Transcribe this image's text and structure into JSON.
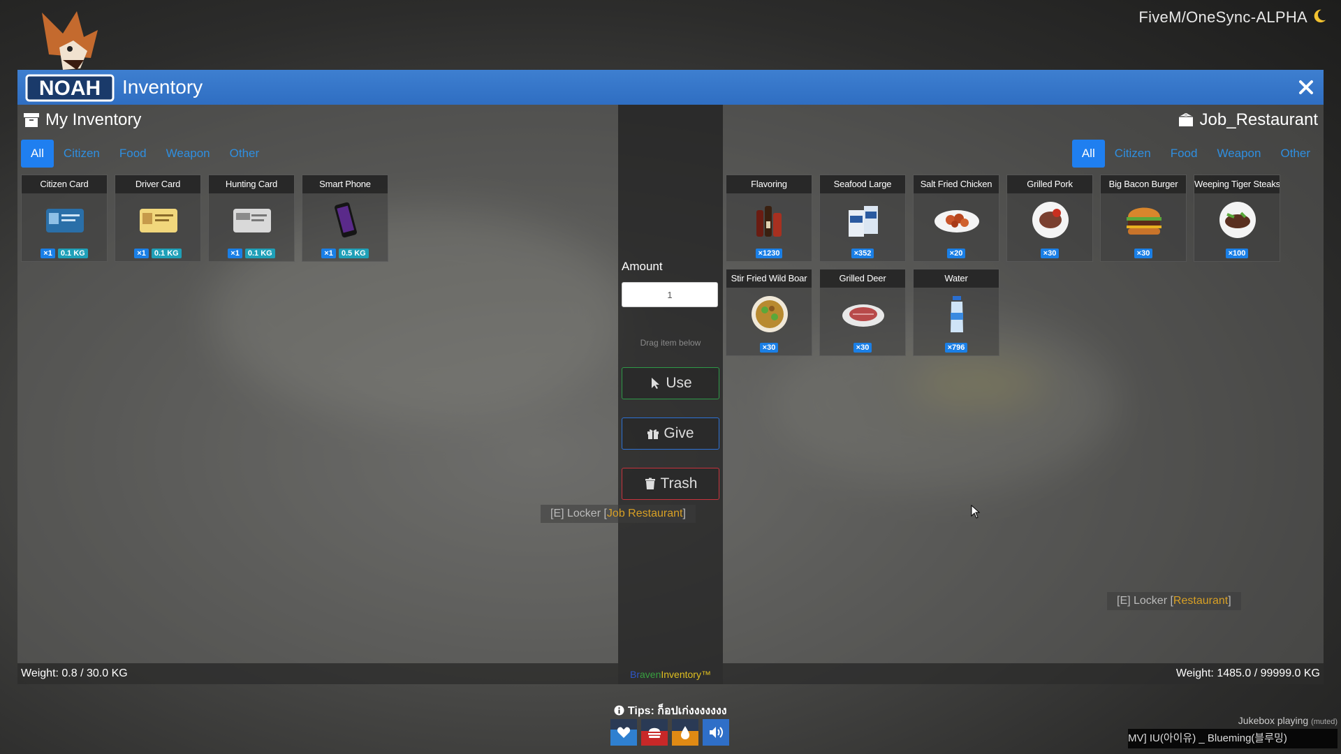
{
  "server": {
    "name": "FiveM/OneSync-ALPHA",
    "icon": "moon-icon"
  },
  "logo": {
    "text": "NOAH"
  },
  "window": {
    "title": "Inventory",
    "close_icon": "close-icon"
  },
  "left_panel": {
    "title": "My Inventory",
    "tabs": [
      {
        "label": "All",
        "active": true
      },
      {
        "label": "Citizen",
        "active": false
      },
      {
        "label": "Food",
        "active": false
      },
      {
        "label": "Weapon",
        "active": false
      },
      {
        "label": "Other",
        "active": false
      }
    ],
    "items": [
      {
        "name": "Citizen Card",
        "count": "×1",
        "weight": "0.1 KG"
      },
      {
        "name": "Driver Card",
        "count": "×1",
        "weight": "0.1 KG"
      },
      {
        "name": "Hunting Card",
        "count": "×1",
        "weight": "0.1 KG"
      },
      {
        "name": "Smart Phone",
        "count": "×1",
        "weight": "0.5 KG"
      }
    ],
    "weight_text": "Weight: 0.8 / 30.0 KG"
  },
  "middle": {
    "amount_label": "Amount",
    "amount_value": "1",
    "drag_hint": "Drag item below",
    "use_label": "Use",
    "give_label": "Give",
    "trash_label": "Trash",
    "brand_part1": "Br",
    "brand_part2": "aven",
    "brand_part3": "Inventory™"
  },
  "right_panel": {
    "title": "Job_Restaurant",
    "tabs": [
      {
        "label": "All",
        "active": true
      },
      {
        "label": "Citizen",
        "active": false
      },
      {
        "label": "Food",
        "active": false
      },
      {
        "label": "Weapon",
        "active": false
      },
      {
        "label": "Other",
        "active": false
      }
    ],
    "items": [
      {
        "name": "Flavoring",
        "count": "×1230"
      },
      {
        "name": "Seafood Large",
        "count": "×352"
      },
      {
        "name": "Salt Fried Chicken",
        "count": "×20"
      },
      {
        "name": "Grilled Pork",
        "count": "×30"
      },
      {
        "name": "Big Bacon Burger",
        "count": "×30"
      },
      {
        "name": "Weeping Tiger Steaks",
        "count": "×100"
      },
      {
        "name": "Stir Fried Wild Boar",
        "count": "×30"
      },
      {
        "name": "Grilled Deer",
        "count": "×30"
      },
      {
        "name": "Water",
        "count": "×796"
      }
    ],
    "weight_text": "Weight: 1485.0 / 99999.0 KG"
  },
  "world_labels": [
    {
      "prefix": "[E] Locker [",
      "highlight": "Job Restaurant",
      "suffix": "]"
    },
    {
      "prefix": "[E] Locker [",
      "highlight": "Restaurant",
      "suffix": "]"
    }
  ],
  "tips": {
    "text": "Tips: ก็อปเก่งงงงงงง",
    "icon": "info-icon"
  },
  "status": [
    {
      "name": "health",
      "icon": "heart-icon",
      "color": "#2f80d0",
      "level": 0.6
    },
    {
      "name": "hunger",
      "icon": "burger-icon",
      "color": "#c82828",
      "level": 0.55
    },
    {
      "name": "thirst",
      "icon": "water-drop-icon",
      "color": "#e08a14",
      "level": 0.55
    },
    {
      "name": "voice",
      "icon": "speaker-icon",
      "color": "#2f6fc8",
      "level": 1.0
    }
  ],
  "jukebox": {
    "status": "Jukebox playing",
    "muted": "(muted)",
    "song": "MV] IU(아이유) _ Blueming(블루밍)"
  }
}
